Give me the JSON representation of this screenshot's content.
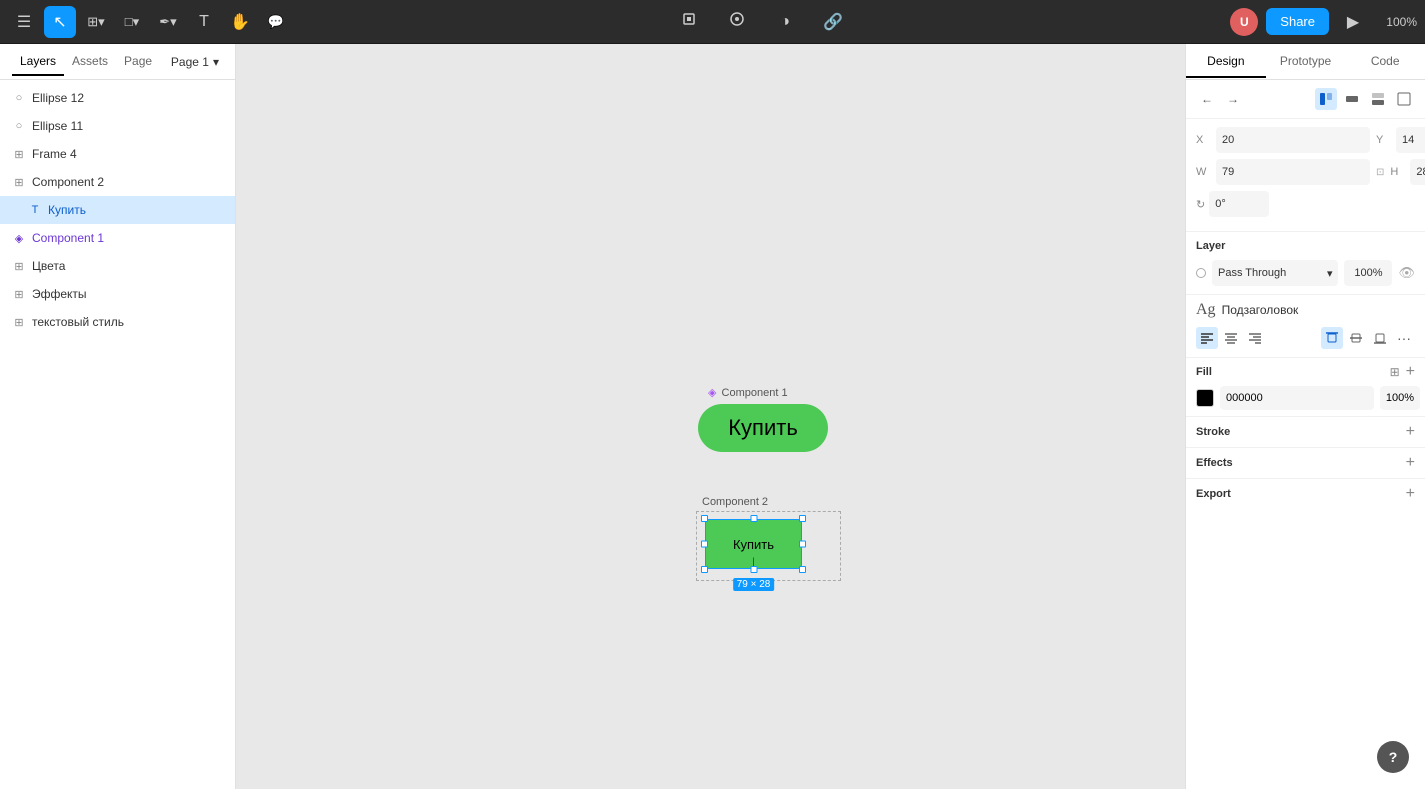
{
  "app": {
    "zoom": "100%"
  },
  "toolbar": {
    "tools": [
      {
        "name": "menu-icon",
        "label": "☰",
        "active": false
      },
      {
        "name": "select-tool",
        "label": "↖",
        "active": true
      },
      {
        "name": "frame-tool",
        "label": "⊞",
        "active": false
      },
      {
        "name": "shape-tool",
        "label": "□",
        "active": false
      },
      {
        "name": "pen-tool",
        "label": "✒",
        "active": false
      },
      {
        "name": "text-tool",
        "label": "T",
        "active": false
      },
      {
        "name": "hand-tool",
        "label": "✋",
        "active": false
      },
      {
        "name": "comment-tool",
        "label": "💬",
        "active": false
      }
    ],
    "center_icons": [
      "component-icon",
      "resource-icon",
      "theme-icon",
      "link-icon"
    ],
    "share_label": "Share",
    "zoom_label": "100%"
  },
  "left_panel": {
    "tabs": [
      {
        "name": "layers-tab",
        "label": "Layers",
        "active": true
      },
      {
        "name": "assets-tab",
        "label": "Assets",
        "active": false
      },
      {
        "name": "page-tab",
        "label": "Page",
        "active": false
      }
    ],
    "page": {
      "name": "page-selector",
      "label": "Page 1",
      "chevron": "▾"
    },
    "layers": [
      {
        "id": "ellipse12",
        "icon": "○",
        "label": "Ellipse 12",
        "indent": 0,
        "selected": false
      },
      {
        "id": "ellipse11",
        "icon": "○",
        "label": "Ellipse 11",
        "indent": 0,
        "selected": false
      },
      {
        "id": "frame4",
        "icon": "⊞",
        "label": "Frame 4",
        "indent": 0,
        "selected": false
      },
      {
        "id": "component2",
        "icon": "⊞",
        "label": "Component 2",
        "indent": 0,
        "selected": false
      },
      {
        "id": "kupity-text",
        "icon": "T",
        "label": "Купить",
        "indent": 1,
        "selected": true
      },
      {
        "id": "component1",
        "icon": "◈",
        "label": "Component 1",
        "indent": 0,
        "selected": false
      },
      {
        "id": "cveta",
        "icon": "⊞",
        "label": "Цвета",
        "indent": 0,
        "selected": false
      },
      {
        "id": "effekty",
        "icon": "⊞",
        "label": "Эффекты",
        "indent": 0,
        "selected": false
      },
      {
        "id": "text-style",
        "icon": "⊞",
        "label": "текстовый стиль",
        "indent": 0,
        "selected": false
      }
    ]
  },
  "canvas": {
    "component1_label": "Component 1",
    "component1_diamond": "◈",
    "component1_text": "Купить",
    "component2_label": "Component 2",
    "selected_text": "Купить",
    "size_badge": "79 × 28"
  },
  "right_panel": {
    "tabs": [
      {
        "name": "design-tab",
        "label": "Design",
        "active": true
      },
      {
        "name": "prototype-tab",
        "label": "Prototype",
        "active": false
      },
      {
        "name": "code-tab",
        "label": "Code",
        "active": false
      }
    ],
    "alignment": {
      "buttons": [
        "←",
        "↔",
        "→",
        "↑",
        "↕",
        "↓",
        "⊡",
        "⊞"
      ]
    },
    "position": {
      "x_label": "X",
      "x_value": "20",
      "y_label": "Y",
      "y_value": "14",
      "w_label": "W",
      "w_value": "79",
      "h_label": "H",
      "h_value": "28",
      "rotation_value": "0°"
    },
    "layer": {
      "title": "Layer",
      "blend_mode": "Pass Through",
      "blend_chevron": "▾",
      "opacity": "100%",
      "eye_visible": true
    },
    "typography": {
      "ag_label": "Ag",
      "style_name": "Подзаголовок",
      "text_align_left": "≡",
      "text_align_center": "≡",
      "text_align_right": "≡",
      "valign_top": "⊤",
      "valign_middle": "⊥",
      "valign_bottom": "⊥",
      "more": "···"
    },
    "fill": {
      "title": "Fill",
      "swatch_color": "#000000",
      "hex_value": "000000",
      "opacity": "100%"
    },
    "stroke": {
      "title": "Stroke"
    },
    "effects": {
      "title": "Effects"
    },
    "export": {
      "title": "Export"
    }
  }
}
